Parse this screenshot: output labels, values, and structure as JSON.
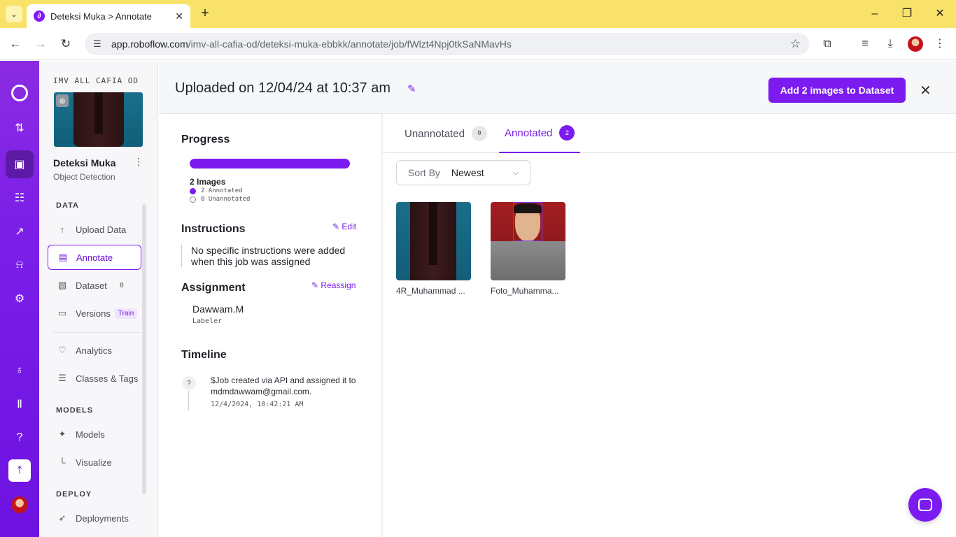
{
  "browser": {
    "tab_title": "Deteksi Muka > Annotate",
    "url_host": "app.roboflow.com",
    "url_path": "/imv-all-cafia-od/deteksi-muka-ebbkk/annotate/job/fWlzt4Npj0tkSaNMavHs"
  },
  "sidebar": {
    "workspace": "IMV ALL CAFIA OD",
    "project_title": "Deteksi Muka",
    "project_type": "Object Detection",
    "section_data": "DATA",
    "section_models": "MODELS",
    "section_deploy": "DEPLOY",
    "items": {
      "upload": "Upload Data",
      "annotate": "Annotate",
      "dataset": "Dataset",
      "dataset_count": "0",
      "versions": "Versions",
      "versions_badge": "Train",
      "analytics": "Analytics",
      "classes": "Classes & Tags",
      "models": "Models",
      "visualize": "Visualize",
      "deployments": "Deployments"
    }
  },
  "header": {
    "title": "Uploaded on 12/04/24 at 10:37 am",
    "add_button": "Add 2 images to Dataset"
  },
  "job": {
    "progress_heading": "Progress",
    "progress_annotated_fraction": 1.0,
    "images_total": "2 Images",
    "annotated_label": "2 Annotated",
    "unannotated_label": "0 Unannotated",
    "instructions_heading": "Instructions",
    "edit_label": "Edit",
    "instructions_text": "No specific instructions were added when this job was assigned",
    "assignment_heading": "Assignment",
    "reassign_label": "Reassign",
    "assignee": "Dawwam.M",
    "role": "Labeler",
    "timeline_heading": "Timeline",
    "timeline_text": "$Job created via API and assigned it to mdmdawwam@gmail.com.",
    "timeline_time": "12/4/2024, 10:42:21 AM"
  },
  "filters": {
    "unannotated_label": "Unannotated",
    "unannotated_count": "0",
    "annotated_label": "Annotated",
    "annotated_count": "2",
    "sort_label": "Sort By",
    "sort_value": "Newest"
  },
  "images": [
    {
      "name": "4R_Muhammad ..."
    },
    {
      "name": "Foto_Muhamma..."
    }
  ],
  "colors": {
    "accent": "#7c1bf0",
    "rail": "#7a1ee8",
    "tabbar": "#f9e26a"
  }
}
